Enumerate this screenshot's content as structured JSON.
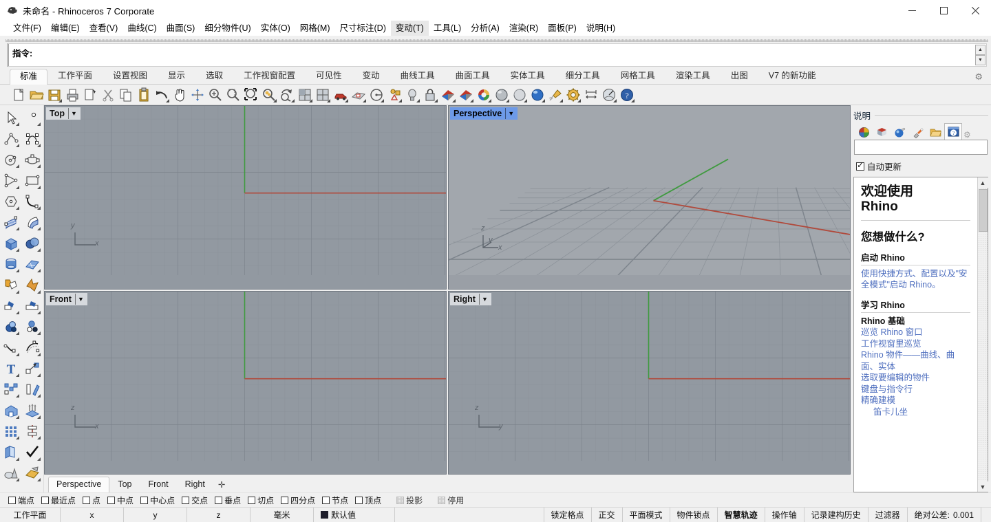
{
  "window": {
    "title": "未命名 - Rhinoceros 7 Corporate",
    "app_icon": "rhino-head-icon",
    "controls": {
      "minimize": "minimize-icon",
      "maximize": "maximize-icon",
      "close": "close-icon"
    }
  },
  "menubar": {
    "items": [
      {
        "label": "文件(F)",
        "name": "menu-file",
        "active": false
      },
      {
        "label": "编辑(E)",
        "name": "menu-edit",
        "active": false
      },
      {
        "label": "查看(V)",
        "name": "menu-view",
        "active": false
      },
      {
        "label": "曲线(C)",
        "name": "menu-curve",
        "active": false
      },
      {
        "label": "曲面(S)",
        "name": "menu-surface",
        "active": false
      },
      {
        "label": "细分物件(U)",
        "name": "menu-subd",
        "active": false
      },
      {
        "label": "实体(O)",
        "name": "menu-solid",
        "active": false
      },
      {
        "label": "网格(M)",
        "name": "menu-mesh",
        "active": false
      },
      {
        "label": "尺寸标注(D)",
        "name": "menu-dimension",
        "active": false
      },
      {
        "label": "变动(T)",
        "name": "menu-transform",
        "active": true
      },
      {
        "label": "工具(L)",
        "name": "menu-tools",
        "active": false
      },
      {
        "label": "分析(A)",
        "name": "menu-analyze",
        "active": false
      },
      {
        "label": "渲染(R)",
        "name": "menu-render",
        "active": false
      },
      {
        "label": "面板(P)",
        "name": "menu-panels",
        "active": false
      },
      {
        "label": "说明(H)",
        "name": "menu-help",
        "active": false
      }
    ]
  },
  "command": {
    "label": "指令:",
    "value": "",
    "placeholder": ""
  },
  "ribbon": {
    "tabs": [
      {
        "label": "标准",
        "name": "ribbon-tab-standard",
        "active": true
      },
      {
        "label": "工作平面",
        "name": "ribbon-tab-cplane",
        "active": false
      },
      {
        "label": "设置视图",
        "name": "ribbon-tab-setview",
        "active": false
      },
      {
        "label": "显示",
        "name": "ribbon-tab-display",
        "active": false
      },
      {
        "label": "选取",
        "name": "ribbon-tab-select",
        "active": false
      },
      {
        "label": "工作视窗配置",
        "name": "ribbon-tab-viewport-layout",
        "active": false
      },
      {
        "label": "可见性",
        "name": "ribbon-tab-visibility",
        "active": false
      },
      {
        "label": "变动",
        "name": "ribbon-tab-transform",
        "active": false
      },
      {
        "label": "曲线工具",
        "name": "ribbon-tab-curve-tools",
        "active": false
      },
      {
        "label": "曲面工具",
        "name": "ribbon-tab-surface-tools",
        "active": false
      },
      {
        "label": "实体工具",
        "name": "ribbon-tab-solid-tools",
        "active": false
      },
      {
        "label": "细分工具",
        "name": "ribbon-tab-subd-tools",
        "active": false
      },
      {
        "label": "网格工具",
        "name": "ribbon-tab-mesh-tools",
        "active": false
      },
      {
        "label": "渲染工具",
        "name": "ribbon-tab-render-tools",
        "active": false
      },
      {
        "label": "出图",
        "name": "ribbon-tab-drafting",
        "active": false
      },
      {
        "label": "V7 的新功能",
        "name": "ribbon-tab-whats-new-v7",
        "active": false
      }
    ],
    "options_icon": "gear-icon"
  },
  "toolbar_icons": [
    {
      "name": "new-file-icon",
      "flyout": false
    },
    {
      "name": "open-file-icon",
      "flyout": false
    },
    {
      "name": "save-file-icon",
      "flyout": true
    },
    {
      "name": "print-icon",
      "flyout": false
    },
    {
      "name": "copy-to-clipboard-icon",
      "flyout": false
    },
    {
      "name": "cut-icon",
      "flyout": false
    },
    {
      "name": "copy-icon",
      "flyout": false
    },
    {
      "name": "paste-icon",
      "flyout": false
    },
    {
      "name": "undo-icon",
      "flyout": true
    },
    {
      "name": "pan-hand-icon",
      "flyout": false
    },
    {
      "name": "rotate-view-icon",
      "flyout": false
    },
    {
      "name": "zoom-in-icon",
      "flyout": false
    },
    {
      "name": "zoom-dynamic-icon",
      "flyout": false
    },
    {
      "name": "zoom-window-icon",
      "flyout": false
    },
    {
      "name": "zoom-extents-icon",
      "flyout": true
    },
    {
      "name": "zoom-selected-icon",
      "flyout": true
    },
    {
      "name": "undo-view-change-icon",
      "flyout": true
    },
    {
      "name": "viewport-layout-4view-icon",
      "flyout": true
    },
    {
      "name": "named-view-car-icon",
      "flyout": true
    },
    {
      "name": "cplane-icon",
      "flyout": true
    },
    {
      "name": "set-view-angle-icon",
      "flyout": true
    },
    {
      "name": "object-properties-icon",
      "flyout": true
    },
    {
      "name": "layer-light-icon",
      "flyout": true
    },
    {
      "name": "lock-object-icon",
      "flyout": true
    },
    {
      "name": "shaded-display-icon",
      "flyout": true
    },
    {
      "name": "rendered-display-icon",
      "flyout": true
    },
    {
      "name": "color-wheel-icon",
      "flyout": true
    },
    {
      "name": "shaded-sphere-icon",
      "flyout": true
    },
    {
      "name": "ghosted-sphere-icon",
      "flyout": true
    },
    {
      "name": "rendered-sphere-icon",
      "flyout": true
    },
    {
      "name": "paint-spray-icon",
      "flyout": true
    },
    {
      "name": "gear-render-settings-icon",
      "flyout": true
    },
    {
      "name": "dimension-icon",
      "flyout": false
    },
    {
      "name": "analysis-icon",
      "flyout": true
    },
    {
      "name": "help-icon",
      "flyout": true
    }
  ],
  "left_rail_icons": [
    "select-arrow-icon",
    "point-icon",
    "polyline-icon",
    "control-point-curve-icon",
    "circle-icon",
    "ellipse-icon",
    "polygon-triangle-icon",
    "rectangle-icon",
    "polygon-icon",
    "arc-fillet-icon",
    "surface-from-points-icon",
    "loft-surface-icon",
    "box-solid-icon",
    "boolean-union-icon",
    "cylinder-pipe-icon",
    "mesh-plane-icon",
    "boolean-difference-icon",
    "explode-icon",
    "trim-icon",
    "split-icon",
    "boolean-intersection-icon",
    "circle-group-icon",
    "blend-curve-icon",
    "offset-curve-icon",
    "text-tool-icon",
    "move-icon",
    "copy-array-icon",
    "mirror-icon",
    "extrude-solid-icon",
    "extrude-array-icon",
    "rectangular-array-icon",
    "linear-array-icon",
    "unroll-surface-icon",
    "check-object-icon",
    "shade-render-icon",
    "render-preview-icon"
  ],
  "viewports": [
    {
      "label": "Top",
      "name": "viewport-top",
      "active": false
    },
    {
      "label": "Perspective",
      "name": "viewport-perspective",
      "active": true
    },
    {
      "label": "Front",
      "name": "viewport-front",
      "active": false
    },
    {
      "label": "Right",
      "name": "viewport-right",
      "active": false
    }
  ],
  "viewport_axes": {
    "top": {
      "v": "y",
      "h": "x"
    },
    "perspective": {
      "v": "z",
      "d": "y",
      "h": "x"
    },
    "front": {
      "v": "z",
      "h": "x"
    },
    "right": {
      "v": "z",
      "h": "y"
    }
  },
  "viewport_tabs": [
    {
      "label": "Perspective",
      "name": "vp-tab-perspective",
      "active": true
    },
    {
      "label": "Top",
      "name": "vp-tab-top",
      "active": false
    },
    {
      "label": "Front",
      "name": "vp-tab-front",
      "active": false
    },
    {
      "label": "Right",
      "name": "vp-tab-right",
      "active": false
    },
    {
      "label": "✛",
      "name": "vp-tab-add",
      "active": false
    }
  ],
  "help_panel": {
    "title": "说明",
    "tabs": [
      {
        "name": "panel-tab-properties-icon",
        "active": false
      },
      {
        "name": "panel-tab-layers-icon",
        "active": false
      },
      {
        "name": "panel-tab-display-icon",
        "active": false
      },
      {
        "name": "panel-tab-lights-icon",
        "active": false
      },
      {
        "name": "panel-tab-libraries-icon",
        "active": false
      },
      {
        "name": "panel-tab-help-icon",
        "active": true
      }
    ],
    "gear_icon": "gear-icon",
    "search_value": "",
    "search_placeholder": "",
    "auto_update_label": "自动更新",
    "auto_update_checked": true,
    "heading": "欢迎使用 Rhino",
    "heading_line1": "欢迎使用",
    "heading_line2": "Rhino",
    "subheading": "您想做什么?",
    "sections": [
      {
        "title": "启动 Rhino",
        "items": [
          {
            "text": "使用快捷方式、配置以及\"安全模式\"启动 Rhino。",
            "bold": false,
            "indent": false
          }
        ]
      },
      {
        "title": "学习 Rhino",
        "items": [
          {
            "text": "Rhino 基础",
            "bold": true,
            "indent": false
          },
          {
            "text": "巡览 Rhino 窗口",
            "bold": false,
            "indent": false
          },
          {
            "text": "工作视窗里巡览",
            "bold": false,
            "indent": false
          },
          {
            "text": "Rhino 物件——曲线、曲面、实体",
            "bold": false,
            "indent": false
          },
          {
            "text": "选取要编辑的物件",
            "bold": false,
            "indent": false
          },
          {
            "text": "键盘与指令行",
            "bold": false,
            "indent": false
          },
          {
            "text": "精确建模",
            "bold": false,
            "indent": false
          },
          {
            "text": "笛卡儿坐",
            "bold": false,
            "indent": true
          }
        ]
      }
    ]
  },
  "osnap": {
    "items": [
      {
        "label": "端点",
        "name": "osnap-end",
        "checked": false,
        "disabled": false
      },
      {
        "label": "最近点",
        "name": "osnap-near",
        "checked": false,
        "disabled": false
      },
      {
        "label": "点",
        "name": "osnap-point",
        "checked": false,
        "disabled": false
      },
      {
        "label": "中点",
        "name": "osnap-mid",
        "checked": false,
        "disabled": false
      },
      {
        "label": "中心点",
        "name": "osnap-cen",
        "checked": false,
        "disabled": false
      },
      {
        "label": "交点",
        "name": "osnap-int",
        "checked": false,
        "disabled": false
      },
      {
        "label": "垂点",
        "name": "osnap-perp",
        "checked": false,
        "disabled": false
      },
      {
        "label": "切点",
        "name": "osnap-tan",
        "checked": false,
        "disabled": false
      },
      {
        "label": "四分点",
        "name": "osnap-quad",
        "checked": false,
        "disabled": false
      },
      {
        "label": "节点",
        "name": "osnap-knot",
        "checked": false,
        "disabled": false
      },
      {
        "label": "顶点",
        "name": "osnap-vertex",
        "checked": false,
        "disabled": false
      },
      {
        "label": "投影",
        "name": "osnap-project",
        "checked": false,
        "disabled": true
      },
      {
        "label": "停用",
        "name": "osnap-disable",
        "checked": false,
        "disabled": true
      }
    ]
  },
  "statusbar": {
    "cplane_label": "工作平面",
    "x_label": "x",
    "y_label": "y",
    "z_label": "z",
    "units": "毫米",
    "layer_color": "#1d1d2b",
    "layer_name": "默认值",
    "toggles": [
      {
        "label": "锁定格点",
        "name": "status-grid-snap",
        "active": false
      },
      {
        "label": "正交",
        "name": "status-ortho",
        "active": false
      },
      {
        "label": "平面模式",
        "name": "status-planar",
        "active": false
      },
      {
        "label": "物件锁点",
        "name": "status-osnap",
        "active": false
      },
      {
        "label": "智慧轨迹",
        "name": "status-smarttrack",
        "active": true
      },
      {
        "label": "操作轴",
        "name": "status-gumball",
        "active": false
      },
      {
        "label": "记录建构历史",
        "name": "status-record-history",
        "active": false
      },
      {
        "label": "过滤器",
        "name": "status-filter",
        "active": false
      }
    ],
    "tolerance_label": "绝对公差:",
    "tolerance_value": "0.001"
  },
  "colors": {
    "viewport_bg": "#9299a1",
    "viewport_persp_bg": "#9a9fa6",
    "grid_line": "#868d95",
    "grid_major": "#787f88",
    "axis_x": "#b04a3c",
    "axis_y": "#3f9a3f",
    "active_viewport_label": "#6d9ae8",
    "link": "#4f6fbf",
    "chrome": "#f0f0f0"
  }
}
